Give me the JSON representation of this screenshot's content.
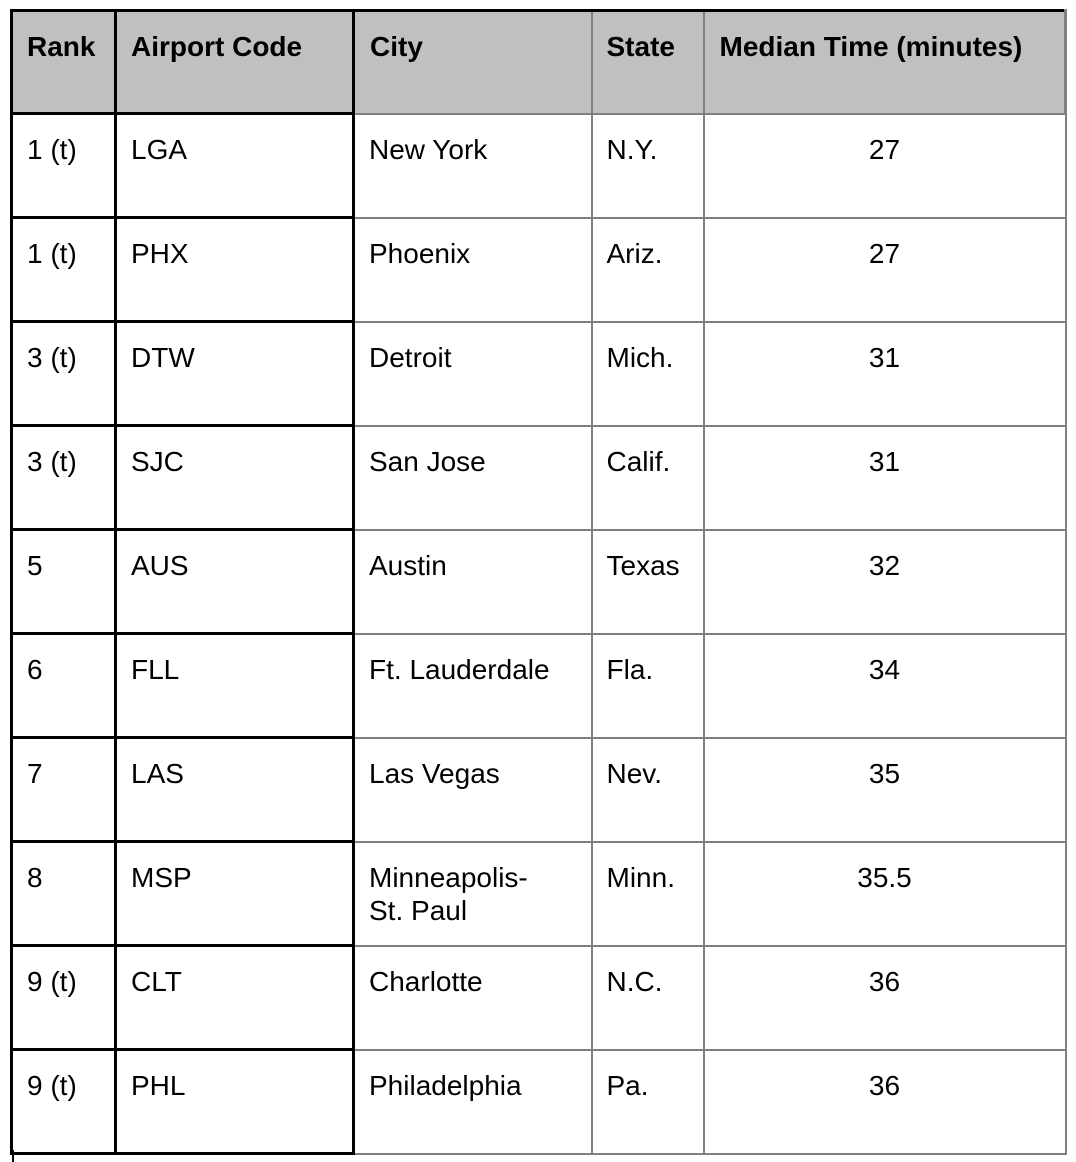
{
  "table": {
    "headers": {
      "rank": "Rank",
      "code": "Airport Code",
      "city": "City",
      "state": "State",
      "time": "Median Time (minutes)"
    },
    "rows": [
      {
        "rank": "1 (t)",
        "code": "LGA",
        "city": "New York",
        "state": "N.Y.",
        "time": "27"
      },
      {
        "rank": "1 (t)",
        "code": "PHX",
        "city": "Phoenix",
        "state": "Ariz.",
        "time": "27"
      },
      {
        "rank": "3 (t)",
        "code": "DTW",
        "city": "Detroit",
        "state": "Mich.",
        "time": "31"
      },
      {
        "rank": "3 (t)",
        "code": "SJC",
        "city": "San Jose",
        "state": "Calif.",
        "time": "31"
      },
      {
        "rank": "5",
        "code": "AUS",
        "city": "Austin",
        "state": "Texas",
        "time": "32"
      },
      {
        "rank": "6",
        "code": "FLL",
        "city": "Ft. Lauderdale",
        "state": "Fla.",
        "time": "34"
      },
      {
        "rank": "7",
        "code": "LAS",
        "city": "Las Vegas",
        "state": "Nev.",
        "time": "35"
      },
      {
        "rank": "8",
        "code": "MSP",
        "city": "Minneapolis-\nSt. Paul",
        "state": "Minn.",
        "time": "35.5"
      },
      {
        "rank": "9 (t)",
        "code": "CLT",
        "city": "Charlotte",
        "state": "N.C.",
        "time": "36"
      },
      {
        "rank": "9 (t)",
        "code": "PHL",
        "city": "Philadelphia",
        "state": "Pa.",
        "time": "36"
      }
    ]
  },
  "colors": {
    "header_bg": "#c0c0c0",
    "dark_border": "#000000",
    "light_border": "#808080"
  }
}
